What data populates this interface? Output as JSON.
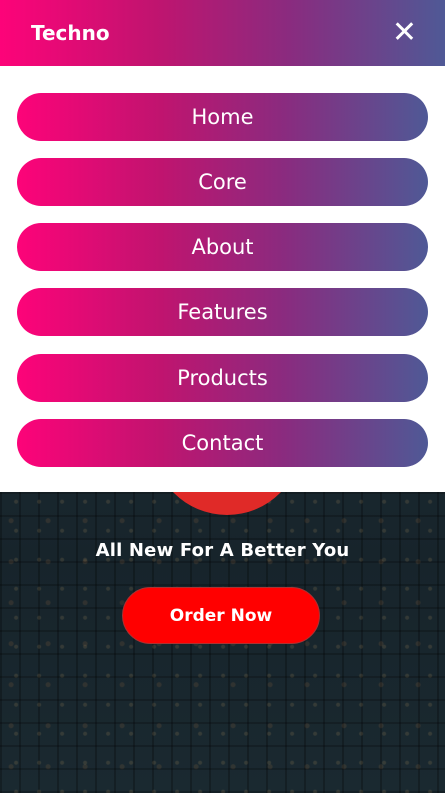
{
  "header": {
    "brand": "Techno",
    "close_icon": "close-icon"
  },
  "menu": {
    "items": [
      {
        "label": "Home"
      },
      {
        "label": "Core"
      },
      {
        "label": "About"
      },
      {
        "label": "Features"
      },
      {
        "label": "Products"
      },
      {
        "label": "Contact"
      }
    ]
  },
  "hero": {
    "tagline": "All New For A Better You",
    "order_button": "Order Now"
  },
  "colors": {
    "gradient_start": "#fd0379",
    "gradient_end": "#4f5996",
    "order_button": "#ff0000"
  }
}
